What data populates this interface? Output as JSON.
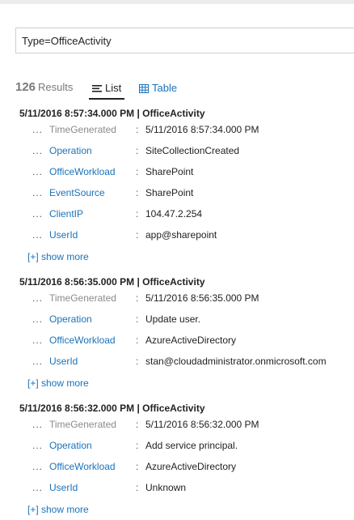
{
  "query": "Type=OfficeActivity",
  "results": {
    "count": "126",
    "label": "Results"
  },
  "tabs": {
    "list": "List",
    "table": "Table"
  },
  "records": [
    {
      "header": "5/11/2016 8:57:34.000 PM | OfficeActivity",
      "fields": [
        {
          "name": "TimeGenerated",
          "value": "5/11/2016 8:57:34.000 PM",
          "style": "gray"
        },
        {
          "name": "Operation",
          "value": "SiteCollectionCreated",
          "style": "link"
        },
        {
          "name": "OfficeWorkload",
          "value": "SharePoint",
          "style": "link"
        },
        {
          "name": "EventSource",
          "value": "SharePoint",
          "style": "link"
        },
        {
          "name": "ClientIP",
          "value": "104.47.2.254",
          "style": "link"
        },
        {
          "name": "UserId",
          "value": "app@sharepoint",
          "style": "link"
        }
      ],
      "more": "[+] show more"
    },
    {
      "header": "5/11/2016 8:56:35.000 PM | OfficeActivity",
      "fields": [
        {
          "name": "TimeGenerated",
          "value": "5/11/2016 8:56:35.000 PM",
          "style": "gray"
        },
        {
          "name": "Operation",
          "value": "Update user.",
          "style": "link"
        },
        {
          "name": "OfficeWorkload",
          "value": "AzureActiveDirectory",
          "style": "link"
        },
        {
          "name": "UserId",
          "value": "stan@cloudadministrator.onmicrosoft.com",
          "style": "link"
        }
      ],
      "more": "[+] show more"
    },
    {
      "header": "5/11/2016 8:56:32.000 PM | OfficeActivity",
      "fields": [
        {
          "name": "TimeGenerated",
          "value": "5/11/2016 8:56:32.000 PM",
          "style": "gray"
        },
        {
          "name": "Operation",
          "value": "Add service principal.",
          "style": "link"
        },
        {
          "name": "OfficeWorkload",
          "value": "AzureActiveDirectory",
          "style": "link"
        },
        {
          "name": "UserId",
          "value": "Unknown",
          "style": "link"
        }
      ],
      "more": "[+] show more"
    }
  ],
  "dots": "...",
  "colon": ":",
  "colors": {
    "link": "#1a72bb",
    "muted": "#8a8a8a",
    "text": "#222222"
  },
  "icons": {
    "list_tab": "list-icon",
    "table_tab": "table-grid-icon"
  }
}
